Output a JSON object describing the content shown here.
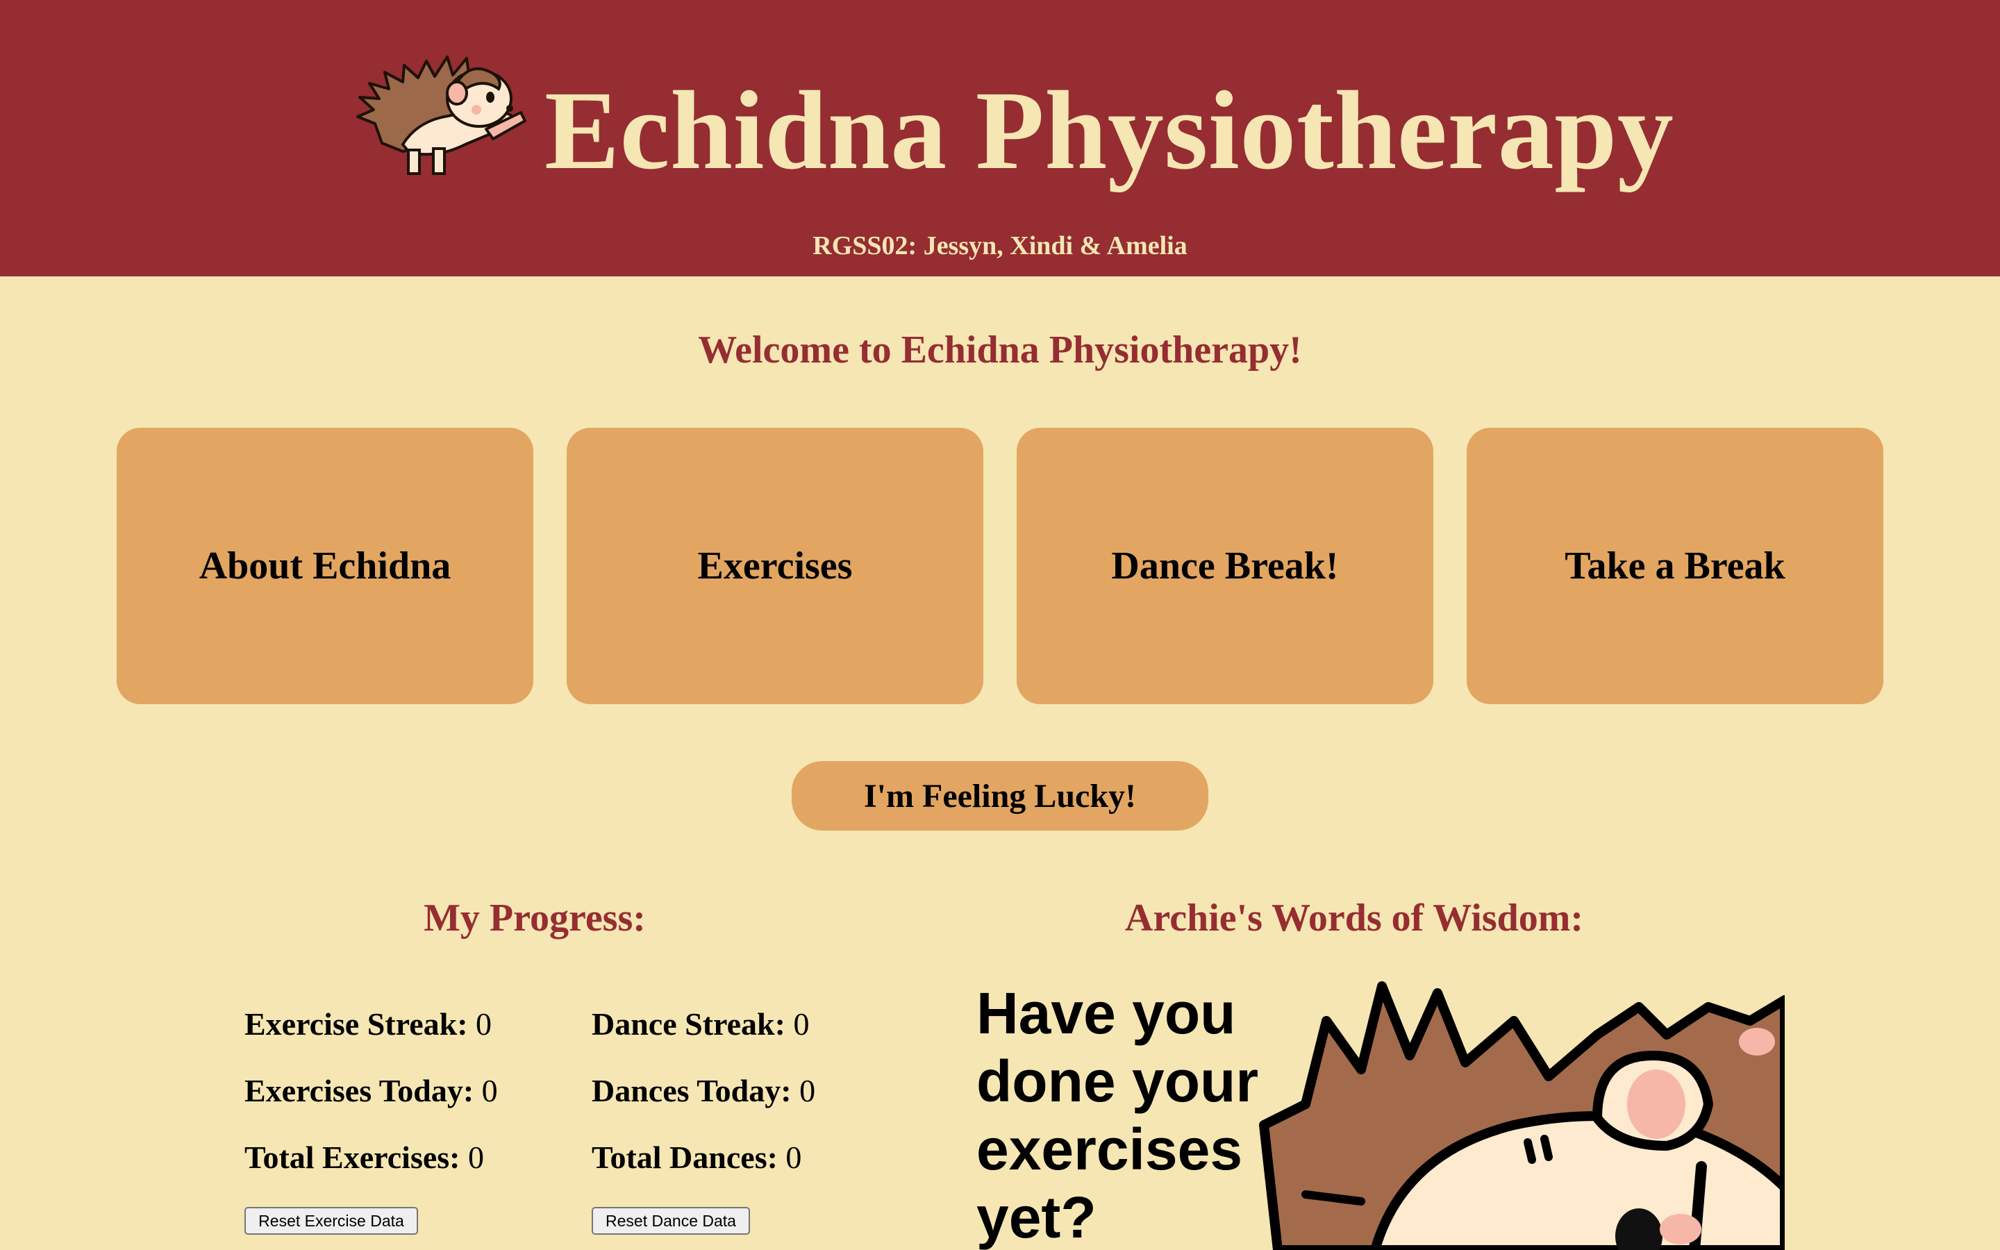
{
  "header": {
    "title": "Echidna Physiotherapy",
    "subtitle": "RGSS02: Jessyn, Xindi & Amelia",
    "logo_icon": "echidna-mascot-icon",
    "bg_color": "#952d32",
    "text_color": "#f5e6b3"
  },
  "welcome": "Welcome to Echidna Physiotherapy!",
  "nav": {
    "cards": [
      {
        "label": "About Echidna"
      },
      {
        "label": "Exercises"
      },
      {
        "label": "Dance Break!"
      },
      {
        "label": "Take a Break"
      }
    ],
    "card_color": "#e2a662"
  },
  "lucky_button": "I'm Feeling Lucky!",
  "progress": {
    "title": "My Progress:",
    "exercise": {
      "streak_label": "Exercise Streak:",
      "streak_value": "0",
      "today_label": "Exercises Today:",
      "today_value": "0",
      "total_label": "Total Exercises:",
      "total_value": "0",
      "reset_label": "Reset Exercise Data"
    },
    "dance": {
      "streak_label": "Dance Streak:",
      "streak_value": "0",
      "today_label": "Dances Today:",
      "today_value": "0",
      "total_label": "Total Dances:",
      "total_value": "0",
      "reset_label": "Reset Dance Data"
    }
  },
  "wisdom": {
    "title": "Archie's Words of Wisdom:",
    "lines": [
      "Have you",
      "done your",
      "exercises",
      "yet?"
    ],
    "image_icon": "archie-mascot-closeup-icon"
  },
  "colors": {
    "background": "#f5e6b3",
    "accent": "#952d32",
    "card": "#e2a662"
  }
}
